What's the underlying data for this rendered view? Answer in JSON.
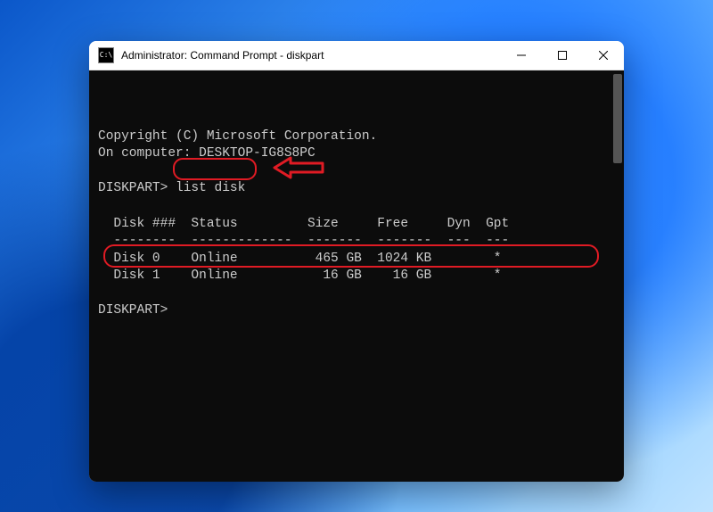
{
  "window": {
    "icon_text": "C:\\",
    "title": "Administrator: Command Prompt - diskpart",
    "controls": {
      "minimize": "minimize",
      "maximize": "maximize",
      "close": "close"
    }
  },
  "terminal": {
    "copyright": "Copyright (C) Microsoft Corporation.",
    "computer_line": "On computer: DESKTOP-IG8S8PC",
    "prompt1_prefix": "DISKPART> ",
    "prompt1_cmd": "list disk",
    "header": "  Disk ###  Status         Size     Free     Dyn  Gpt",
    "divider": "  --------  -------------  -------  -------  ---  ---",
    "row0": "  Disk 0    Online          465 GB  1024 KB        *",
    "row1": "  Disk 1    Online           16 GB    16 GB        *",
    "prompt2": "DISKPART>"
  },
  "annotations": {
    "command_highlight": "list disk",
    "arrow": "red-arrow-left",
    "row_highlight": "Disk 1"
  },
  "colors": {
    "annotation": "#e01b24",
    "terminal_bg": "#0c0c0c",
    "terminal_fg": "#cccccc"
  }
}
